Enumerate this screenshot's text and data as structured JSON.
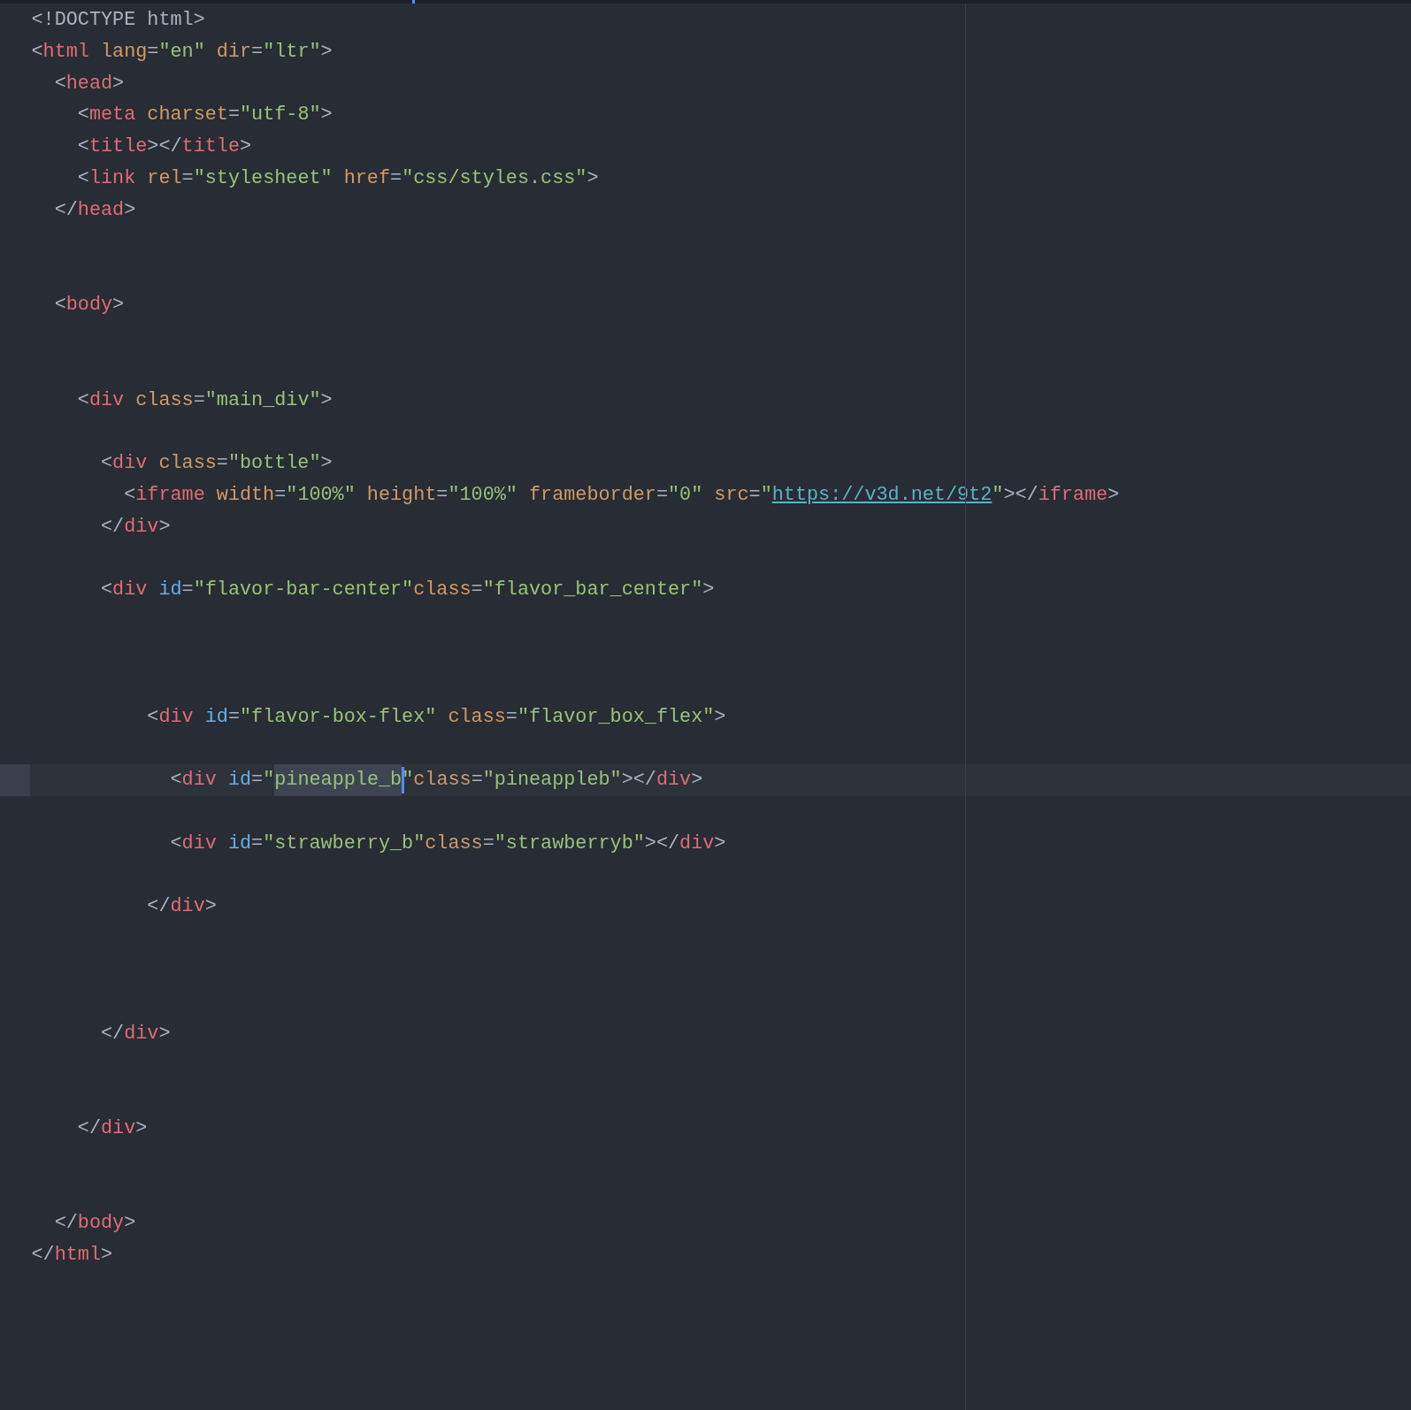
{
  "editor": {
    "lines": [
      {
        "current": false,
        "tokens": [
          {
            "kind": "punct",
            "text": "<!DOCTYPE html>"
          }
        ]
      },
      {
        "current": false,
        "tokens": [
          {
            "kind": "punct",
            "text": "<"
          },
          {
            "kind": "tag",
            "text": "html"
          },
          {
            "kind": "attr",
            "text": " lang"
          },
          {
            "kind": "punct",
            "text": "="
          },
          {
            "kind": "str",
            "text": "\"en\""
          },
          {
            "kind": "attr",
            "text": " dir"
          },
          {
            "kind": "punct",
            "text": "="
          },
          {
            "kind": "str",
            "text": "\"ltr\""
          },
          {
            "kind": "punct",
            "text": ">"
          }
        ]
      },
      {
        "current": false,
        "tokens": [
          {
            "kind": "punct",
            "text": "  <"
          },
          {
            "kind": "tag",
            "text": "head"
          },
          {
            "kind": "punct",
            "text": ">"
          }
        ]
      },
      {
        "current": false,
        "tokens": [
          {
            "kind": "punct",
            "text": "    <"
          },
          {
            "kind": "tag",
            "text": "meta"
          },
          {
            "kind": "attr",
            "text": " charset"
          },
          {
            "kind": "punct",
            "text": "="
          },
          {
            "kind": "str",
            "text": "\"utf-8\""
          },
          {
            "kind": "punct",
            "text": ">"
          }
        ]
      },
      {
        "current": false,
        "tokens": [
          {
            "kind": "punct",
            "text": "    <"
          },
          {
            "kind": "tag",
            "text": "title"
          },
          {
            "kind": "punct",
            "text": "></"
          },
          {
            "kind": "tag",
            "text": "title"
          },
          {
            "kind": "punct",
            "text": ">"
          }
        ]
      },
      {
        "current": false,
        "tokens": [
          {
            "kind": "punct",
            "text": "    <"
          },
          {
            "kind": "tag",
            "text": "link"
          },
          {
            "kind": "attr",
            "text": " rel"
          },
          {
            "kind": "punct",
            "text": "="
          },
          {
            "kind": "str",
            "text": "\"stylesheet\""
          },
          {
            "kind": "attr",
            "text": " href"
          },
          {
            "kind": "punct",
            "text": "="
          },
          {
            "kind": "str",
            "text": "\"css/styles.css\""
          },
          {
            "kind": "punct",
            "text": ">"
          }
        ]
      },
      {
        "current": false,
        "tokens": [
          {
            "kind": "punct",
            "text": "  </"
          },
          {
            "kind": "tag",
            "text": "head"
          },
          {
            "kind": "punct",
            "text": ">"
          }
        ]
      },
      {
        "current": false
      },
      {
        "current": false
      },
      {
        "current": false,
        "tokens": [
          {
            "kind": "punct",
            "text": "  <"
          },
          {
            "kind": "tag",
            "text": "body"
          },
          {
            "kind": "punct",
            "text": ">"
          }
        ]
      },
      {
        "current": false
      },
      {
        "current": false
      },
      {
        "current": false,
        "tokens": [
          {
            "kind": "punct",
            "text": "    <"
          },
          {
            "kind": "tag",
            "text": "div"
          },
          {
            "kind": "attr",
            "text": " class"
          },
          {
            "kind": "punct",
            "text": "="
          },
          {
            "kind": "str",
            "text": "\"main_div\""
          },
          {
            "kind": "punct",
            "text": ">"
          }
        ]
      },
      {
        "current": false
      },
      {
        "current": false,
        "tokens": [
          {
            "kind": "punct",
            "text": "      <"
          },
          {
            "kind": "tag",
            "text": "div"
          },
          {
            "kind": "attr",
            "text": " class"
          },
          {
            "kind": "punct",
            "text": "="
          },
          {
            "kind": "str",
            "text": "\"bottle\""
          },
          {
            "kind": "punct",
            "text": ">"
          }
        ]
      },
      {
        "current": false,
        "tokens": [
          {
            "kind": "punct",
            "text": "        <"
          },
          {
            "kind": "tag",
            "text": "iframe"
          },
          {
            "kind": "attr",
            "text": " width"
          },
          {
            "kind": "punct",
            "text": "="
          },
          {
            "kind": "str",
            "text": "\"100%\""
          },
          {
            "kind": "attr",
            "text": " height"
          },
          {
            "kind": "punct",
            "text": "="
          },
          {
            "kind": "str",
            "text": "\"100%\""
          },
          {
            "kind": "attr",
            "text": " frameborder"
          },
          {
            "kind": "punct",
            "text": "="
          },
          {
            "kind": "str",
            "text": "\"0\""
          },
          {
            "kind": "attr",
            "text": " src"
          },
          {
            "kind": "punct",
            "text": "="
          },
          {
            "kind": "str",
            "text": "\""
          },
          {
            "kind": "link",
            "text": "https://v3d.net/9t2"
          },
          {
            "kind": "str",
            "text": "\""
          },
          {
            "kind": "punct",
            "text": "></"
          },
          {
            "kind": "tag",
            "text": "iframe"
          },
          {
            "kind": "punct",
            "text": ">"
          }
        ]
      },
      {
        "current": false,
        "tokens": [
          {
            "kind": "punct",
            "text": "      </"
          },
          {
            "kind": "tag",
            "text": "div"
          },
          {
            "kind": "punct",
            "text": ">"
          }
        ]
      },
      {
        "current": false
      },
      {
        "current": false,
        "tokens": [
          {
            "kind": "punct",
            "text": "      <"
          },
          {
            "kind": "tag",
            "text": "div"
          },
          {
            "kind": "id",
            "text": " id"
          },
          {
            "kind": "punct",
            "text": "="
          },
          {
            "kind": "str",
            "text": "\"flavor-bar-center\""
          },
          {
            "kind": "attr",
            "text": "class"
          },
          {
            "kind": "punct",
            "text": "="
          },
          {
            "kind": "str",
            "text": "\"flavor_bar_center\""
          },
          {
            "kind": "punct",
            "text": ">"
          }
        ]
      },
      {
        "current": false
      },
      {
        "current": false
      },
      {
        "current": false
      },
      {
        "current": false,
        "tokens": [
          {
            "kind": "punct",
            "text": "          <"
          },
          {
            "kind": "tag",
            "text": "div"
          },
          {
            "kind": "id",
            "text": " id"
          },
          {
            "kind": "punct",
            "text": "="
          },
          {
            "kind": "str",
            "text": "\"flavor-box-flex\""
          },
          {
            "kind": "attr",
            "text": " class"
          },
          {
            "kind": "punct",
            "text": "="
          },
          {
            "kind": "str",
            "text": "\"flavor_box_flex\""
          },
          {
            "kind": "punct",
            "text": ">"
          }
        ]
      },
      {
        "current": false
      },
      {
        "current": true,
        "tokens": [
          {
            "kind": "punct",
            "text": "            <"
          },
          {
            "kind": "tag",
            "text": "div"
          },
          {
            "kind": "id",
            "text": " id"
          },
          {
            "kind": "punct",
            "text": "="
          },
          {
            "kind": "str",
            "text": "\""
          },
          {
            "kind": "sel",
            "text": "pineapple_b"
          },
          {
            "kind": "str",
            "text": "\""
          },
          {
            "kind": "attr",
            "text": "class"
          },
          {
            "kind": "punct",
            "text": "="
          },
          {
            "kind": "str",
            "text": "\"pineappleb\""
          },
          {
            "kind": "punct",
            "text": "></"
          },
          {
            "kind": "tag",
            "text": "div"
          },
          {
            "kind": "punct",
            "text": ">"
          }
        ]
      },
      {
        "current": false
      },
      {
        "current": false,
        "tokens": [
          {
            "kind": "punct",
            "text": "            <"
          },
          {
            "kind": "tag",
            "text": "div"
          },
          {
            "kind": "id",
            "text": " id"
          },
          {
            "kind": "punct",
            "text": "="
          },
          {
            "kind": "str",
            "text": "\"strawberry_b\""
          },
          {
            "kind": "attr",
            "text": "class"
          },
          {
            "kind": "punct",
            "text": "="
          },
          {
            "kind": "str",
            "text": "\"strawberryb\""
          },
          {
            "kind": "punct",
            "text": "></"
          },
          {
            "kind": "tag",
            "text": "div"
          },
          {
            "kind": "punct",
            "text": ">"
          }
        ]
      },
      {
        "current": false
      },
      {
        "current": false,
        "tokens": [
          {
            "kind": "punct",
            "text": "          </"
          },
          {
            "kind": "tag",
            "text": "div"
          },
          {
            "kind": "punct",
            "text": ">"
          }
        ]
      },
      {
        "current": false
      },
      {
        "current": false
      },
      {
        "current": false
      },
      {
        "current": false,
        "tokens": [
          {
            "kind": "punct",
            "text": "      </"
          },
          {
            "kind": "tag",
            "text": "div"
          },
          {
            "kind": "punct",
            "text": ">"
          }
        ]
      },
      {
        "current": false
      },
      {
        "current": false
      },
      {
        "current": false,
        "tokens": [
          {
            "kind": "punct",
            "text": "    </"
          },
          {
            "kind": "tag",
            "text": "div"
          },
          {
            "kind": "punct",
            "text": ">"
          }
        ]
      },
      {
        "current": false
      },
      {
        "current": false
      },
      {
        "current": false,
        "tokens": [
          {
            "kind": "punct",
            "text": "  </"
          },
          {
            "kind": "tag",
            "text": "body"
          },
          {
            "kind": "punct",
            "text": ">"
          }
        ]
      },
      {
        "current": false,
        "tokens": [
          {
            "kind": "punct",
            "text": "</"
          },
          {
            "kind": "tag",
            "text": "html"
          },
          {
            "kind": "punct",
            "text": ">"
          }
        ]
      }
    ]
  }
}
